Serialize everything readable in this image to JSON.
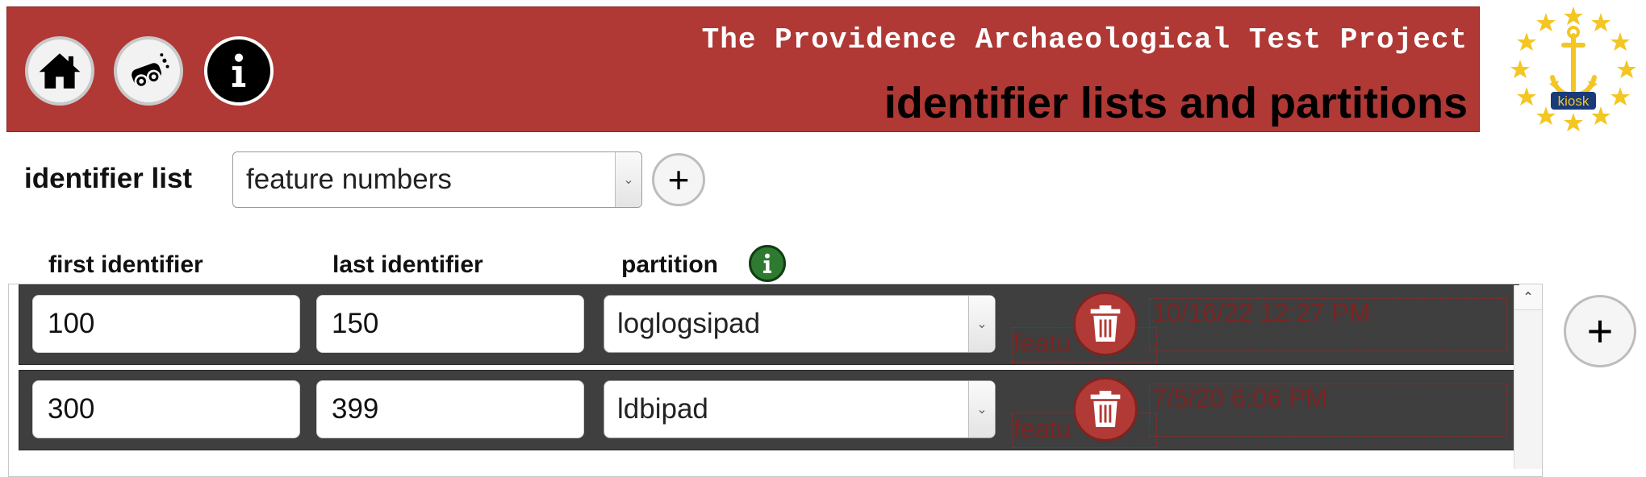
{
  "header": {
    "title": "The Providence Archaeological Test Project",
    "subtitle": "identifier lists and partitions",
    "logo_text": "kiosk",
    "colors": {
      "banner": "#b03835",
      "title_text": "#ffffff",
      "subtitle_text": "#000000"
    }
  },
  "nav": [
    {
      "name": "home",
      "icon": "home-icon"
    },
    {
      "name": "tools",
      "icon": "binoculars-icon"
    },
    {
      "name": "info",
      "icon": "info-icon"
    }
  ],
  "identifier_list": {
    "label": "identifier list",
    "selected": "feature numbers",
    "add_label": "+"
  },
  "columns": {
    "first": "first identifier",
    "last": "last identifier",
    "partition": "partition",
    "partition_info_icon": "info-icon"
  },
  "rows": [
    {
      "first": "100",
      "last": "150",
      "partition": "loglogsipad",
      "timestamp": "10/16/22 12:27 PM",
      "ghost_label": "featu"
    },
    {
      "first": "300",
      "last": "399",
      "partition": "ldbipad",
      "timestamp": "7/5/20 6:06 PM",
      "ghost_label": "featu"
    }
  ],
  "add_row_label": "+"
}
